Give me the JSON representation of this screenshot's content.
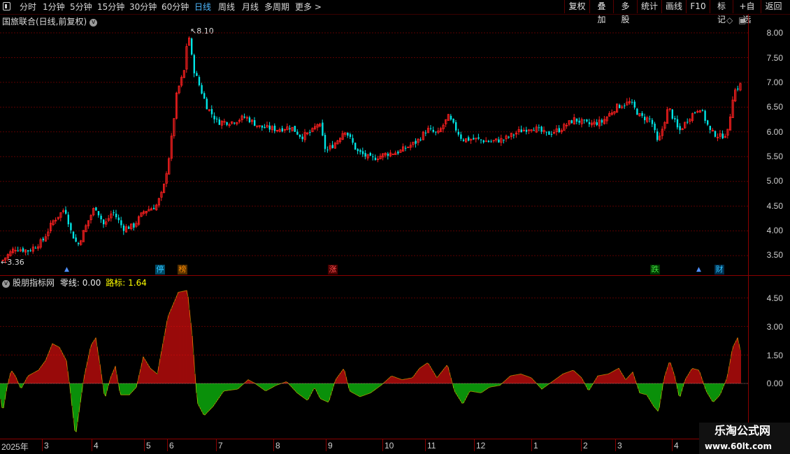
{
  "toolbar": {
    "periods": [
      "分时",
      "1分钟",
      "5分钟",
      "15分钟",
      "30分钟",
      "60分钟",
      "日线",
      "周线",
      "月线",
      "多周期",
      "更多 >"
    ],
    "active": "日线",
    "right_buttons": [
      "复权",
      "叠加",
      "多股",
      "统计",
      "画线",
      "F10",
      "标记",
      "+自选",
      "返回"
    ]
  },
  "main_panel": {
    "title": "国旅联合(日线,前复权)",
    "dropdown_icon": "chevron-down-icon",
    "high_label": "8.10",
    "low_label": "3.36",
    "y_ticks": [
      "8.00",
      "7.50",
      "7.00",
      "6.50",
      "6.00",
      "5.50",
      "5.00",
      "4.50",
      "4.00",
      "3.50"
    ]
  },
  "markers": [
    {
      "text": "停",
      "color": "#2ec4ff"
    },
    {
      "text": "榜",
      "color": "#ff8c00"
    },
    {
      "text": "涨",
      "color": "#ff3030"
    },
    {
      "text": "跌",
      "color": "#30d030"
    },
    {
      "text": "财",
      "color": "#2ec4ff"
    }
  ],
  "indicator_panel": {
    "name": "股朋指标网",
    "line1_label": "零线:",
    "line1_value": "0.00",
    "line2_label": "路标:",
    "line2_value": "1.64",
    "y_ticks": [
      "4.50",
      "3.00",
      "1.50",
      "0.00"
    ]
  },
  "x_axis": [
    "2025年",
    "3",
    "4",
    "5",
    "6",
    "7",
    "8",
    "9",
    "10",
    "11",
    "12",
    "1",
    "2",
    "3",
    "4"
  ],
  "watermark": {
    "line1": "乐淘公式网",
    "line2": "www.60lt.com"
  },
  "colors": {
    "up": "#ff2020",
    "down": "#00e5e5",
    "pos_bar": "#ff1010",
    "neg_bar": "#10f010",
    "grid": "#8b0000",
    "accent": "#4fb8ff"
  }
}
